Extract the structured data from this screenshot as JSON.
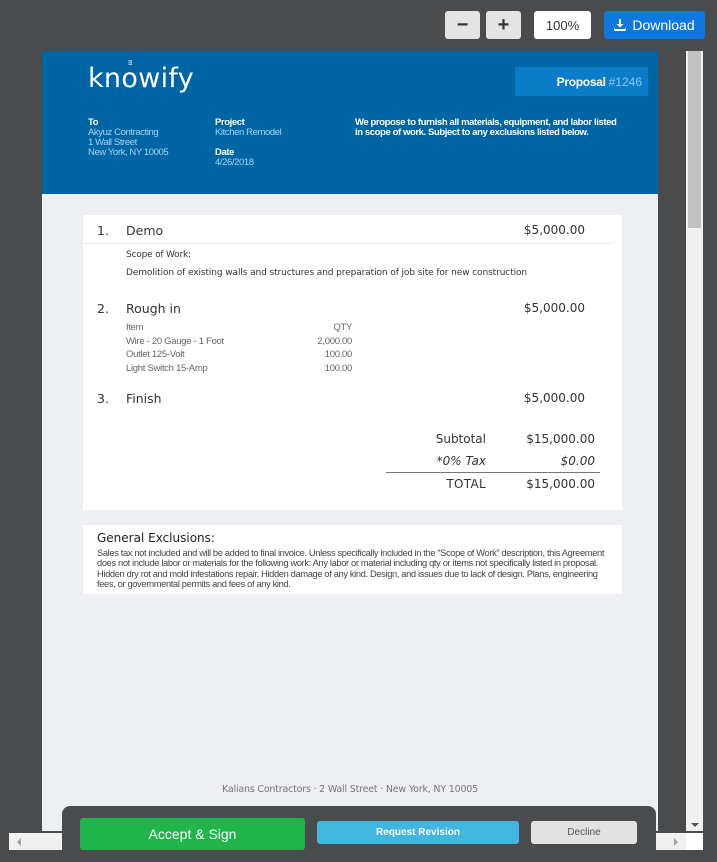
{
  "toolbar": {
    "zoom_out_label": "−",
    "zoom_in_label": "+",
    "zoom_level": "100%",
    "download_label": "Download",
    "download_icon": "download-icon"
  },
  "header": {
    "logo_prefix": "kn",
    "logo_o": "o",
    "logo_suffix": "wify",
    "logo_rays": "⁞⁞⁞",
    "proposal_label": "Proposal",
    "proposal_number": "#1246",
    "to_label": "To",
    "to_name": "Akyuz Contracting",
    "to_street": "1 Wall Street",
    "to_city": "New York, NY 10005",
    "project_label": "Project",
    "project_value": "Kitchen Remodel",
    "date_label": "Date",
    "date_value": "4/26/2018",
    "intro_text": "We propose to furnish all materials, equipment, and labor listed in scope of work. Subject to any exclusions listed below."
  },
  "items": [
    {
      "number": "1.",
      "name": "Demo",
      "amount": "$5,000.00",
      "scope_label": "Scope of Work:",
      "scope_text": "Demolition of existing walls and structures and preparation of job site for new construction"
    },
    {
      "number": "2.",
      "name": "Rough in",
      "amount": "$5,000.00",
      "materials_header": {
        "item": "Item",
        "qty": "QTY"
      },
      "materials": [
        {
          "item": "Wire - 20 Gauge - 1 Foot",
          "qty": "2,000.00"
        },
        {
          "item": "Outlet 125-Volt",
          "qty": "100.00"
        },
        {
          "item": "Light Switch 15-Amp",
          "qty": "100.00"
        }
      ]
    },
    {
      "number": "3.",
      "name": "Finish",
      "amount": "$5,000.00"
    }
  ],
  "totals": {
    "subtotal_label": "Subtotal",
    "subtotal_value": "$15,000.00",
    "tax_label": "*0% Tax",
    "tax_value": "$0.00",
    "total_label": "TOTAL",
    "total_value": "$15,000.00"
  },
  "exclusions": {
    "title": "General Exclusions:",
    "text": "Sales tax not included and will be added to final invoice. Unless specifically included in the “Scope of Work” description, this Agreement does not include labor or materials for the following work: Any labor or material including qty or items not specifically listed in proposal. Hidden dry rot and mold infestations repair. Hidden damage of any kind. Design, and issues due to lack of design. Plans, engineering fees, or governmental permits and fees of any kind."
  },
  "footer": {
    "address": "Kalians Contractors · 2 Wall Street · New York, NY 10005"
  },
  "actions": {
    "accept_label": "Accept & Sign",
    "revision_label": "Request Revision",
    "decline_label": "Decline"
  },
  "colors": {
    "header_bg": "#0065a4",
    "badge_bg": "#0a7cc8",
    "accept": "#20b54a",
    "revision": "#41b6df",
    "download": "#0f78e0"
  }
}
